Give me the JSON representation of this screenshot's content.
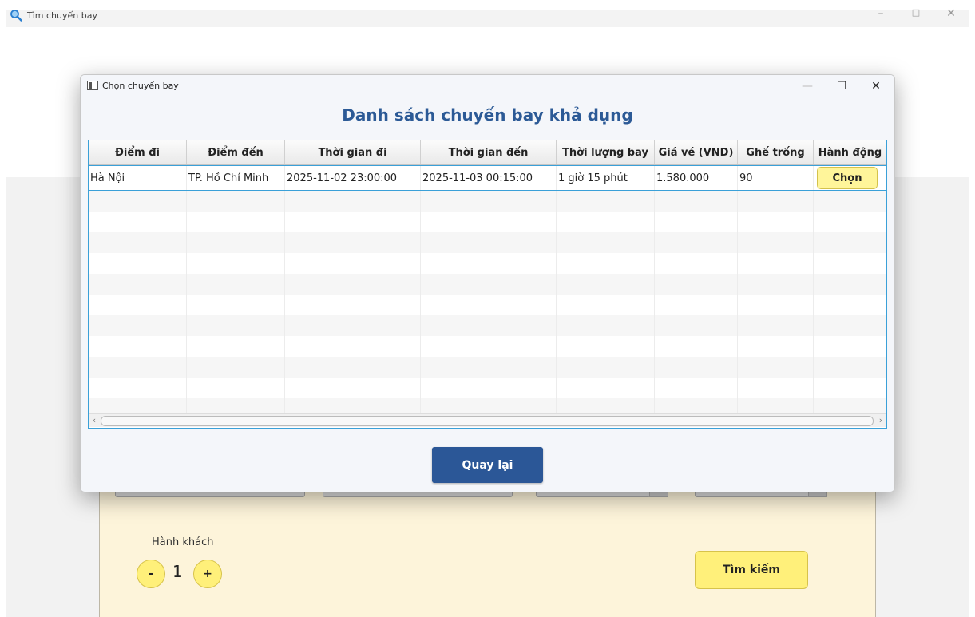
{
  "main_window": {
    "title": "Tìm chuyến bay",
    "title_icon": "search-icon",
    "passenger_label": "Hành khách",
    "passenger_count": "1",
    "minus_label": "-",
    "plus_label": "+",
    "search_button": "Tìm kiếm",
    "minimize": "–",
    "maximize": "□",
    "close": "✕"
  },
  "dialog": {
    "title": "Chọn chuyến bay",
    "heading": "Danh sách chuyến bay khả dụng",
    "minimize": "—",
    "maximize": "☐",
    "close": "✕",
    "columns": [
      "Điểm đi",
      "Điểm đến",
      "Thời gian đi",
      "Thời gian đến",
      "Thời lượng bay",
      "Giá vé (VND)",
      "Ghế trống",
      "Hành động"
    ],
    "rows": [
      {
        "origin": "Hà Nội",
        "destination": "TP. Hồ Chí Minh",
        "departure": "2025-11-02 23:00:00",
        "arrival": "2025-11-03 00:15:00",
        "duration": "1 giờ 15 phút",
        "price": "1.580.000",
        "seats": "90",
        "action": "Chọn"
      }
    ],
    "back_button": "Quay lại"
  },
  "colors": {
    "heading": "#2c5a96",
    "back_button": "#2b5797",
    "yellow_button": "#fff07a",
    "table_border": "#3aa0d8"
  }
}
